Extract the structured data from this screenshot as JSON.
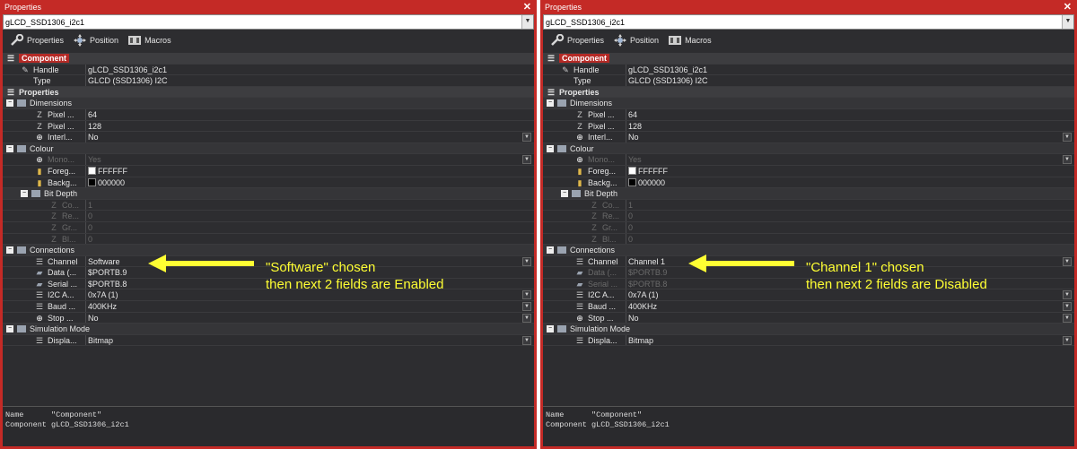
{
  "colors": {
    "frame": "#c42a26",
    "panel_bg": "#2d2d30",
    "annotation": "#ffff33"
  },
  "panels": [
    {
      "title": "Properties",
      "selector_value": "gLCD_SSD1306_i2c1",
      "toolbar": {
        "properties": "Properties",
        "position": "Position",
        "macros": "Macros"
      },
      "rows": {
        "component": "Component",
        "handle_name": "Handle",
        "handle_val": "gLCD_SSD1306_i2c1",
        "type_name": "Type",
        "type_val": "GLCD (SSD1306) I2C",
        "properties": "Properties",
        "dimensions": "Dimensions",
        "px1_name": "Pixel ...",
        "px1_val": "64",
        "px2_name": "Pixel ...",
        "px2_val": "128",
        "interl_name": "Interl...",
        "interl_val": "No",
        "colour": "Colour",
        "mono_name": "Mono...",
        "mono_val": "Yes",
        "fore_name": "Foreg...",
        "fore_val": "FFFFFF",
        "back_name": "Backg...",
        "back_val": "000000",
        "bitdepth": "Bit Depth",
        "co_name": "Co...",
        "co_val": "1",
        "re_name": "Re...",
        "re_val": "0",
        "gr_name": "Gr...",
        "gr_val": "0",
        "bl_name": "Bl...",
        "bl_val": "0",
        "connections": "Connections",
        "channel_name": "Channel",
        "channel_val": "Software",
        "data_name": "Data (...",
        "data_val": "$PORTB.9",
        "serial_name": "Serial ...",
        "serial_val": "$PORTB.8",
        "i2c_name": "I2C A...",
        "i2c_val": "0x7A (1)",
        "baud_name": "Baud ...",
        "baud_val": "400KHz",
        "stop_name": "Stop ...",
        "stop_val": "No",
        "sim": "Simulation Mode",
        "disp_name": "Displa...",
        "disp_val": "Bitmap"
      },
      "info_line1": "Name      \"Component\"",
      "info_line2": "Component gLCD_SSD1306_i2c1",
      "annotation_line1": "\"Software\" chosen",
      "annotation_line2": "then next 2 fields are Enabled"
    },
    {
      "title": "Properties",
      "selector_value": "gLCD_SSD1306_i2c1",
      "toolbar": {
        "properties": "Properties",
        "position": "Position",
        "macros": "Macros"
      },
      "rows": {
        "component": "Component",
        "handle_name": "Handle",
        "handle_val": "gLCD_SSD1306_i2c1",
        "type_name": "Type",
        "type_val": "GLCD (SSD1306) I2C",
        "properties": "Properties",
        "dimensions": "Dimensions",
        "px1_name": "Pixel ...",
        "px1_val": "64",
        "px2_name": "Pixel ...",
        "px2_val": "128",
        "interl_name": "Interl...",
        "interl_val": "No",
        "colour": "Colour",
        "mono_name": "Mono...",
        "mono_val": "Yes",
        "fore_name": "Foreg...",
        "fore_val": "FFFFFF",
        "back_name": "Backg...",
        "back_val": "000000",
        "bitdepth": "Bit Depth",
        "co_name": "Co...",
        "co_val": "1",
        "re_name": "Re...",
        "re_val": "0",
        "gr_name": "Gr...",
        "gr_val": "0",
        "bl_name": "Bl...",
        "bl_val": "0",
        "connections": "Connections",
        "channel_name": "Channel",
        "channel_val": "Channel 1",
        "data_name": "Data (...",
        "data_val": "$PORTB.9",
        "serial_name": "Serial ...",
        "serial_val": "$PORTB.8",
        "i2c_name": "I2C A...",
        "i2c_val": "0x7A (1)",
        "baud_name": "Baud ...",
        "baud_val": "400KHz",
        "stop_name": "Stop ...",
        "stop_val": "No",
        "sim": "Simulation Mode",
        "disp_name": "Displa...",
        "disp_val": "Bitmap"
      },
      "info_line1": "Name      \"Component\"",
      "info_line2": "Component gLCD_SSD1306_i2c1",
      "annotation_line1": "\"Channel 1\" chosen",
      "annotation_line2": "then next 2 fields are Disabled"
    }
  ]
}
